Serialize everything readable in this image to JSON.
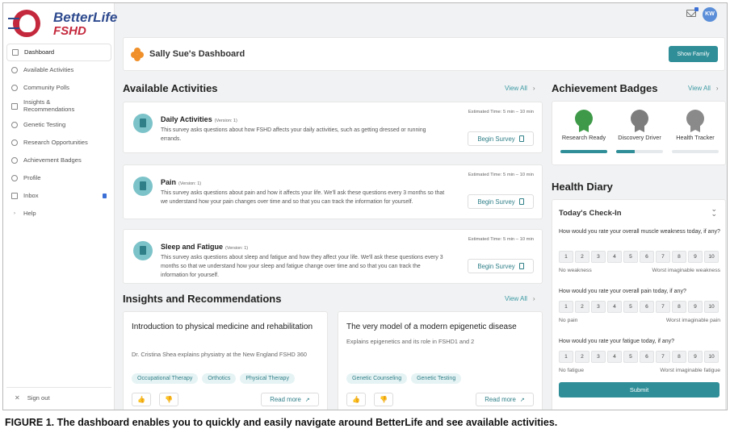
{
  "brand": {
    "name_line1": "BetterLife",
    "name_line2": "FSHD"
  },
  "user": {
    "initials": "KW"
  },
  "sidebar": {
    "items": [
      {
        "label": "Dashboard"
      },
      {
        "label": "Available Activities"
      },
      {
        "label": "Community Polls"
      },
      {
        "label": "Insights & Recommendations"
      },
      {
        "label": "Genetic Testing"
      },
      {
        "label": "Research Opportunities"
      },
      {
        "label": "Achievement Badges"
      },
      {
        "label": "Profile"
      },
      {
        "label": "Inbox"
      },
      {
        "label": "Help"
      }
    ],
    "signout": "Sign out"
  },
  "header": {
    "title": "Sally Sue's Dashboard",
    "show_family": "Show Family"
  },
  "activities": {
    "heading": "Available Activities",
    "view_all": "View All",
    "items": [
      {
        "name": "Daily Activities",
        "version": "(Version: 1)",
        "description": "This survey asks questions about how FSHD affects your daily activities, such as getting dressed or running errands.",
        "estimate": "Estimated Time: 5 min – 10 min",
        "button": "Begin Survey"
      },
      {
        "name": "Pain",
        "version": "(Version: 1)",
        "description": "This survey asks questions about pain and how it affects your life. We'll ask these questions every 3 months so that we understand how your pain changes over time and so that you can track the information for yourself.",
        "estimate": "Estimated Time: 5 min – 10 min",
        "button": "Begin Survey"
      },
      {
        "name": "Sleep and Fatigue",
        "version": "(Version: 1)",
        "description": "This survey asks questions about sleep and fatigue and how they affect your life. We'll ask these questions every 3 months so that we understand how your sleep and fatigue change over time and so that you can track the information for yourself.",
        "estimate": "Estimated Time: 5 min – 10 min",
        "button": "Begin Survey"
      }
    ]
  },
  "insights": {
    "heading": "Insights and Recommendations",
    "view_all": "View All",
    "items": [
      {
        "title": "Introduction to physical medicine and rehabilitation",
        "description": "Dr. Cristina Shea explains physiatry at the New England FSHD 360",
        "tags": [
          "Occupational Therapy",
          "Orthotics",
          "Physical Therapy"
        ],
        "read_more": "Read more"
      },
      {
        "title": "The very model of a modern epigenetic disease",
        "description": "Explains epigenetics and its role in FSHD1 and 2",
        "tags": [
          "Genetic Counseling",
          "Genetic Testing"
        ],
        "read_more": "Read more"
      }
    ]
  },
  "badges": {
    "heading": "Achievement Badges",
    "view_all": "View All",
    "items": [
      {
        "label": "Research Ready",
        "progress": 1.0,
        "color": "#3e9a48"
      },
      {
        "label": "Discovery Driver",
        "progress": 0.4,
        "color": "#7d7d7d"
      },
      {
        "label": "Health Tracker",
        "progress": 0.0,
        "color": "#8a8a8a"
      }
    ]
  },
  "diary": {
    "heading": "Health Diary",
    "checkin": "Today's Check-In",
    "scale": [
      "1",
      "2",
      "3",
      "4",
      "5",
      "6",
      "7",
      "8",
      "9",
      "10"
    ],
    "questions": [
      {
        "text": "How would you rate your overall muscle weakness today, if any?",
        "low": "No weakness",
        "high": "Worst imaginable weakness"
      },
      {
        "text": "How would you rate your overall pain today, if any?",
        "low": "No pain",
        "high": "Worst imaginable pain"
      },
      {
        "text": "How would you rate your fatigue today, if any?",
        "low": "No fatigue",
        "high": "Worst imaginable fatigue"
      }
    ],
    "submit": "Submit"
  },
  "caption": "FIGURE 1. The dashboard enables you to quickly and easily navigate around BetterLife and see available activities.",
  "colors": {
    "accent": "#2f8e98",
    "brand_blue": "#2f4b8f",
    "brand_red": "#c4283c"
  }
}
